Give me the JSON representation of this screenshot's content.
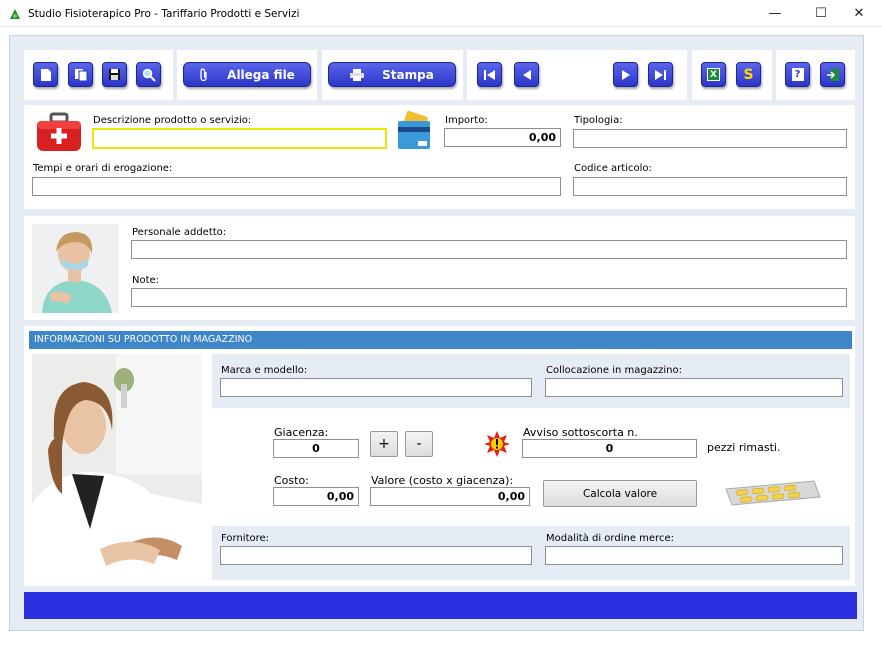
{
  "window": {
    "title": "Studio Fisioterapico Pro - Tariffario Prodotti e Servizi",
    "minimize_glyph": "—",
    "maximize_glyph": "☐",
    "close_glyph": "✕"
  },
  "toolbar": {
    "attach_label": "Allega file",
    "print_label": "Stampa",
    "excel_letter": "X",
    "s_letter": "S",
    "help_glyph": "?"
  },
  "product": {
    "description_label": "Descrizione prodotto o servizio:",
    "description_value": "",
    "amount_label": "Importo:",
    "amount_value": "0,00",
    "type_label": "Tipologia:",
    "type_value": "",
    "times_label": "Tempi e orari di erogazione:",
    "times_value": "",
    "code_label": "Codice articolo:",
    "code_value": ""
  },
  "staff": {
    "personnel_label": "Personale addetto:",
    "personnel_value": "",
    "notes_label": "Note:",
    "notes_value": ""
  },
  "warehouse": {
    "section_title": "INFORMAZIONI SU PRODOTTO IN MAGAZZINO",
    "brand_label": "Marca e modello:",
    "brand_value": "",
    "location_label": "Collocazione in magazzino:",
    "location_value": "",
    "stock_label": "Giacenza:",
    "stock_value": "0",
    "plus_label": "+",
    "minus_label": "-",
    "alert_label": "Avviso sottoscorta n.",
    "alert_value": "0",
    "alert_suffix": "pezzi rimasti.",
    "cost_label": "Costo:",
    "cost_value": "0,00",
    "value_label": "Valore (costo x giacenza):",
    "value_value": "0,00",
    "calc_label": "Calcola valore",
    "supplier_label": "Fornitore:",
    "supplier_value": "",
    "order_label": "Modalità di ordine merce:",
    "order_value": ""
  },
  "colors": {
    "button_blue": "#2b35c9",
    "section_blue": "#3f86c9",
    "status_bar": "#2a2fe0",
    "focus_border": "#e8e800"
  }
}
